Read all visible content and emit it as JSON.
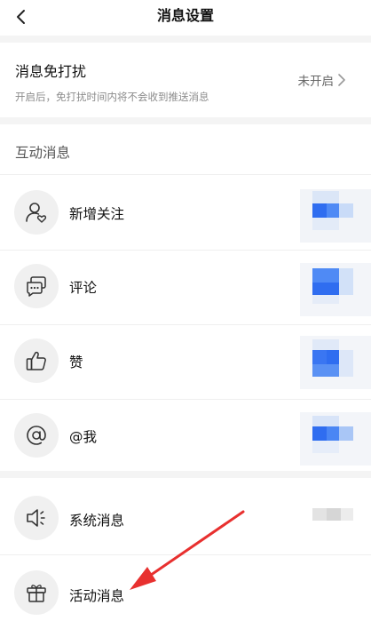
{
  "header": {
    "title": "消息设置",
    "back_icon": "chevron-left-icon"
  },
  "dnd": {
    "title": "消息免打扰",
    "subtitle": "开启后，免打扰时间内将不会收到推送消息",
    "status": "未开启"
  },
  "interaction": {
    "section_title": "互动消息",
    "items": [
      {
        "label": "新增关注",
        "icon": "user-heart-icon"
      },
      {
        "label": "评论",
        "icon": "comment-icon"
      },
      {
        "label": "赞",
        "icon": "thumbs-up-icon"
      },
      {
        "label": "@我",
        "icon": "at-icon"
      }
    ]
  },
  "system": {
    "items": [
      {
        "label": "系统消息",
        "icon": "speaker-icon"
      },
      {
        "label": "活动消息",
        "icon": "gift-icon"
      }
    ]
  },
  "colors": {
    "accent_blue": "#2f6df0",
    "arrow_red": "#e8302f"
  }
}
